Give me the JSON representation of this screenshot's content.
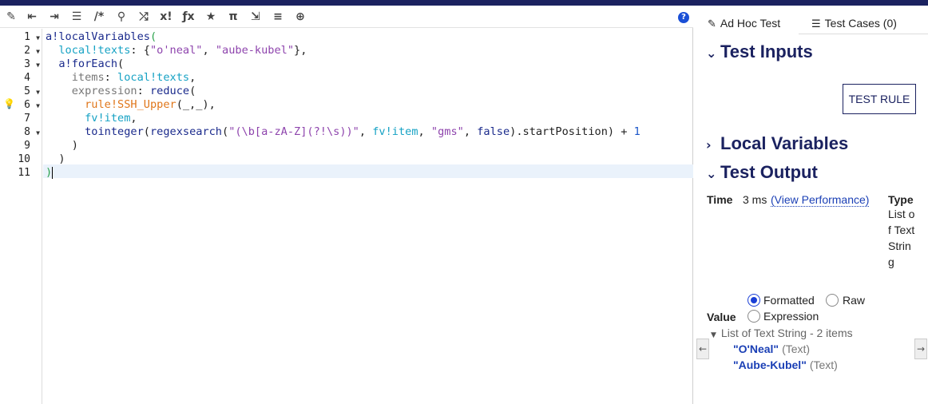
{
  "toolbar": {
    "icons": [
      "magic-wand-icon",
      "outdent-icon",
      "indent-icon",
      "list-icon",
      "comment-icon",
      "search-icon",
      "shuffle-icon",
      "exclamation-icon",
      "function-icon",
      "star-icon",
      "pi-icon",
      "export-icon",
      "database-search-icon",
      "globe-icon",
      "help-icon"
    ],
    "glyphs": [
      "✎",
      "⇤",
      "⇥",
      "☰",
      "/*",
      "⚲",
      "⤮",
      "x!",
      "ƒx",
      "★",
      "π",
      "⇲",
      "≡",
      "⊕",
      "?"
    ]
  },
  "editor": {
    "line_numbers": [
      "1",
      "2",
      "3",
      "4",
      "5",
      "6",
      "7",
      "8",
      "9",
      "10",
      "11"
    ],
    "code": {
      "l1_fn": "a!localVariables",
      "l1_paren": "(",
      "l2_var": "local!texts",
      "l2_mid": ": {",
      "l2_s1": "\"o'neal\"",
      "l2_comma": ", ",
      "l2_s2": "\"aube-kubel\"",
      "l2_end": "},",
      "l3_fn": "a!forEach",
      "l3_paren": "(",
      "l4_kw": "items",
      "l4_colon": ": ",
      "l4_var": "local!texts",
      "l4_end": ",",
      "l5_kw": "expression",
      "l5_colon": ": ",
      "l5_fn": "reduce",
      "l5_paren": "(",
      "l6_rule": "rule!SSH_Upper",
      "l6_rest": "(_,_),",
      "l7_var": "fv!item",
      "l7_end": ",",
      "l8_fn1": "tointeger",
      "l8_p1": "(",
      "l8_fn2": "regexsearch",
      "l8_p2": "(",
      "l8_s1": "\"(\\b[a-zA-Z](?!\\s))\"",
      "l8_c1": ", ",
      "l8_var": "fv!item",
      "l8_c2": ", ",
      "l8_s2": "\"gms\"",
      "l8_c3": ", ",
      "l8_bool": "false",
      "l8_rest": ").startPosition) + ",
      "l8_num": "1",
      "l9": ")",
      "l10": ")",
      "l11": ")"
    }
  },
  "panel": {
    "tabs": {
      "adhoc": "Ad Hoc Test",
      "cases": "Test Cases (0)"
    },
    "sections": {
      "inputs": "Test Inputs",
      "local": "Local Variables",
      "output": "Test Output"
    },
    "test_rule_button": "TEST RULE",
    "time_label": "Time",
    "time_value": "3 ms",
    "view_performance": "(View Performance)",
    "type_label": "Type",
    "type_value": "List of Text String",
    "value_label": "Value",
    "radio": {
      "formatted": "Formatted",
      "raw": "Raw",
      "expression": "Expression"
    },
    "result_header": "List of Text String - 2 items",
    "results": [
      {
        "value": "\"O'Neal\"",
        "type": "(Text)"
      },
      {
        "value": "\"Aube-Kubel\"",
        "type": "(Text)"
      }
    ]
  },
  "colors": {
    "brand": "#1b2260",
    "link": "#1a3fb5",
    "string": "#8e44ad",
    "variable": "#16a2c4",
    "rule": "#e0761a"
  }
}
